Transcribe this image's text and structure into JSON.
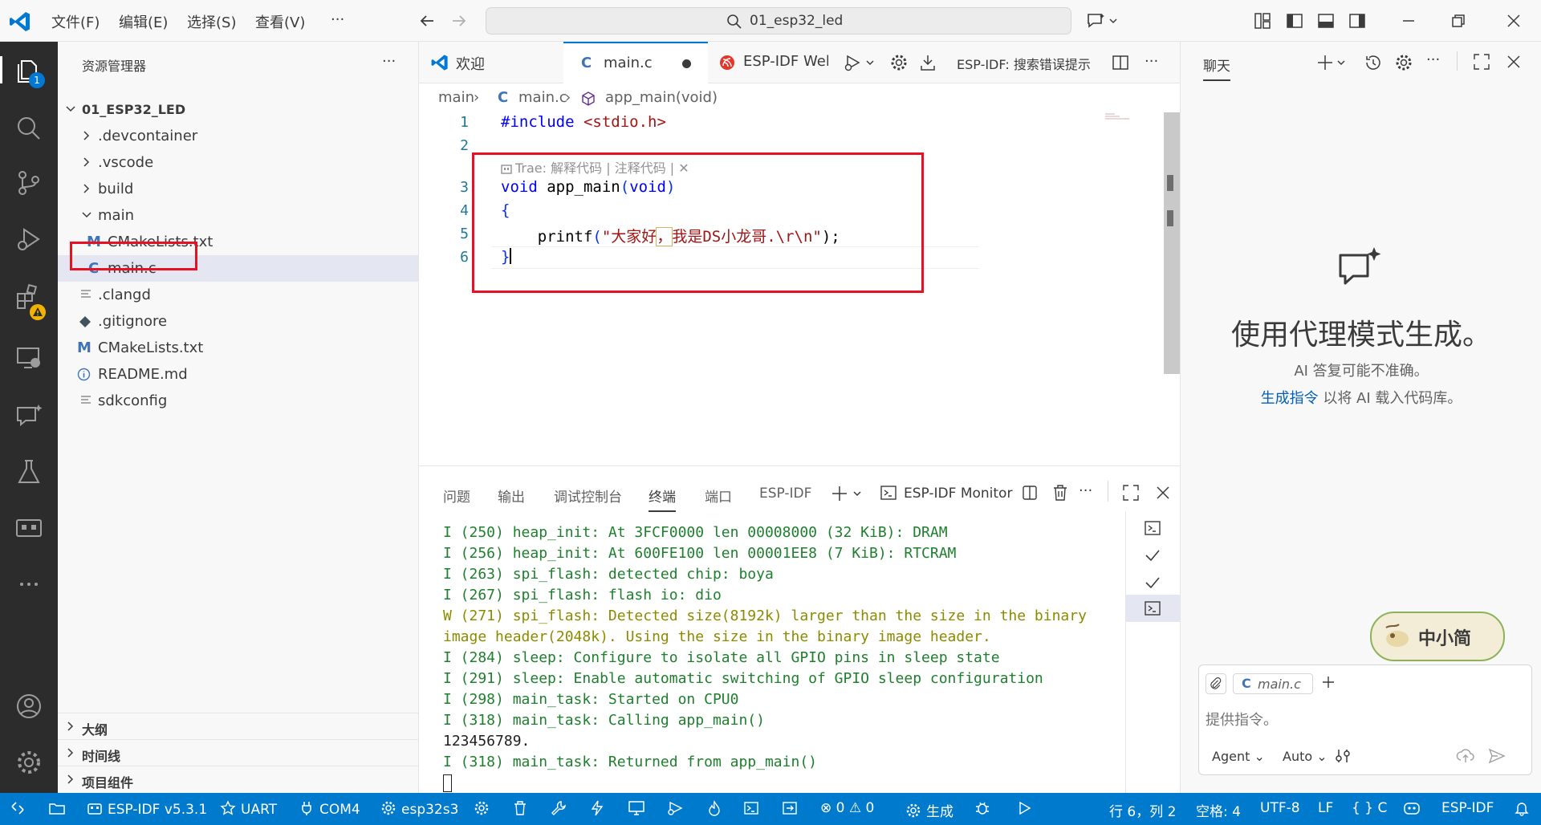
{
  "menu": {
    "file": "文件(F)",
    "edit": "编辑(E)",
    "select": "选择(S)",
    "view": "查看(V)",
    "more": "···"
  },
  "search": {
    "text": "01_esp32_led"
  },
  "sidebar": {
    "title": "资源管理器",
    "more": "···",
    "root": "01_ESP32_LED",
    "items": [
      {
        "label": ".devcontainer"
      },
      {
        "label": ".vscode"
      },
      {
        "label": "build"
      },
      {
        "label": "main"
      },
      {
        "label": "CMakeLists.txt",
        "icon_text": "M"
      },
      {
        "label": "main.c",
        "icon_text": "C"
      },
      {
        "label": ".clangd"
      },
      {
        "label": ".gitignore"
      },
      {
        "label": "CMakeLists.txt",
        "icon_text": "M"
      },
      {
        "label": "README.md"
      },
      {
        "label": "sdkconfig"
      }
    ],
    "sections": {
      "outline": "大纲",
      "timeline": "时间线",
      "components": "项目组件"
    },
    "explorer_badge": "1"
  },
  "tabs": {
    "welcome": "欢迎",
    "main": "main.c",
    "main_icon": "C",
    "espidf": "ESP-IDF Welc",
    "search_label": "ESP-IDF: 搜索错误提示",
    "more": "···"
  },
  "breadcrumb": {
    "folder": "main",
    "file": "main.c",
    "file_icon": "C",
    "symbol": "app_main(void)"
  },
  "editor": {
    "line_numbers": [
      "1",
      "2",
      "3",
      "4",
      "5",
      "6"
    ],
    "codelens": "Trae: 解释代码 | 注释代码 | ✕",
    "include_kw": "#include",
    "include_file": "<stdio.h>",
    "void_kw": "void",
    "func_name": "app_main",
    "params_open": "(",
    "params_kw": "void",
    "params_close": ")",
    "brace_open": "{",
    "printf": "printf",
    "printf_open": "(",
    "printf_str1": "\"大家好",
    "printf_comma": "，",
    "printf_str2": "我是DS小龙哥.\\r\\n\"",
    "printf_close": ");",
    "brace_close": "}"
  },
  "panel": {
    "tabs": [
      "问题",
      "输出",
      "调试控制台",
      "终端",
      "端口",
      "ESP-IDF"
    ],
    "monitor_label": "ESP-IDF Monitor",
    "more": "···",
    "terminal_lines": [
      {
        "text": "I (250) heap_init: At 3FCF0000 len 00008000 (32 KiB): DRAM",
        "kind": "info"
      },
      {
        "text": "I (256) heap_init: At 600FE100 len 00001EE8 (7 KiB): RTCRAM",
        "kind": "info"
      },
      {
        "text": "I (263) spi_flash: detected chip: boya",
        "kind": "info"
      },
      {
        "text": "I (267) spi_flash: flash io: dio",
        "kind": "info"
      },
      {
        "text": "W (271) spi_flash: Detected size(8192k) larger than the size in the binary",
        "kind": "warn"
      },
      {
        "text": "image header(2048k). Using the size in the binary image header.",
        "kind": "warn"
      },
      {
        "text": "I (284) sleep: Configure to isolate all GPIO pins in sleep state",
        "kind": "info"
      },
      {
        "text": "I (291) sleep: Enable automatic switching of GPIO sleep configuration",
        "kind": "info"
      },
      {
        "text": "I (298) main_task: Started on CPU0",
        "kind": "info"
      },
      {
        "text": "I (318) main_task: Calling app_main()",
        "kind": "info"
      },
      {
        "text": "123456789.",
        "kind": "plain"
      },
      {
        "text": "I (318) main_task: Returned from app_main()",
        "kind": "info"
      }
    ]
  },
  "chat": {
    "title": "聊天",
    "more": "···",
    "heading": "使用代理模式生成。",
    "sub1": "AI 答复可能不准确。",
    "sub2_link": "生成指令",
    "sub2_rest": " 以将 AI 载入代码库。",
    "context_file": "main.c",
    "context_icon": "C",
    "placeholder": "提供指令。",
    "mode": "Agent",
    "model": "Auto",
    "watermark_text": "中小简"
  },
  "statusbar": {
    "idf_version": "ESP-IDF v5.3.1",
    "uart": "UART",
    "port": "COM4",
    "target": "esp32s3",
    "problems": "⊗ 0 ⚠ 0",
    "build": "生成",
    "position": "行 6，列 2",
    "spaces": "空格: 4",
    "encoding": "UTF-8",
    "eol": "LF",
    "lang": "{ } C",
    "idf": "ESP-IDF"
  },
  "colors": {
    "accent": "#007acc",
    "activity_bg": "#2c2c2c",
    "highlight_red": "#e81123",
    "terminal_green": "#1e7f2d",
    "terminal_warn": "#8b8b00"
  }
}
